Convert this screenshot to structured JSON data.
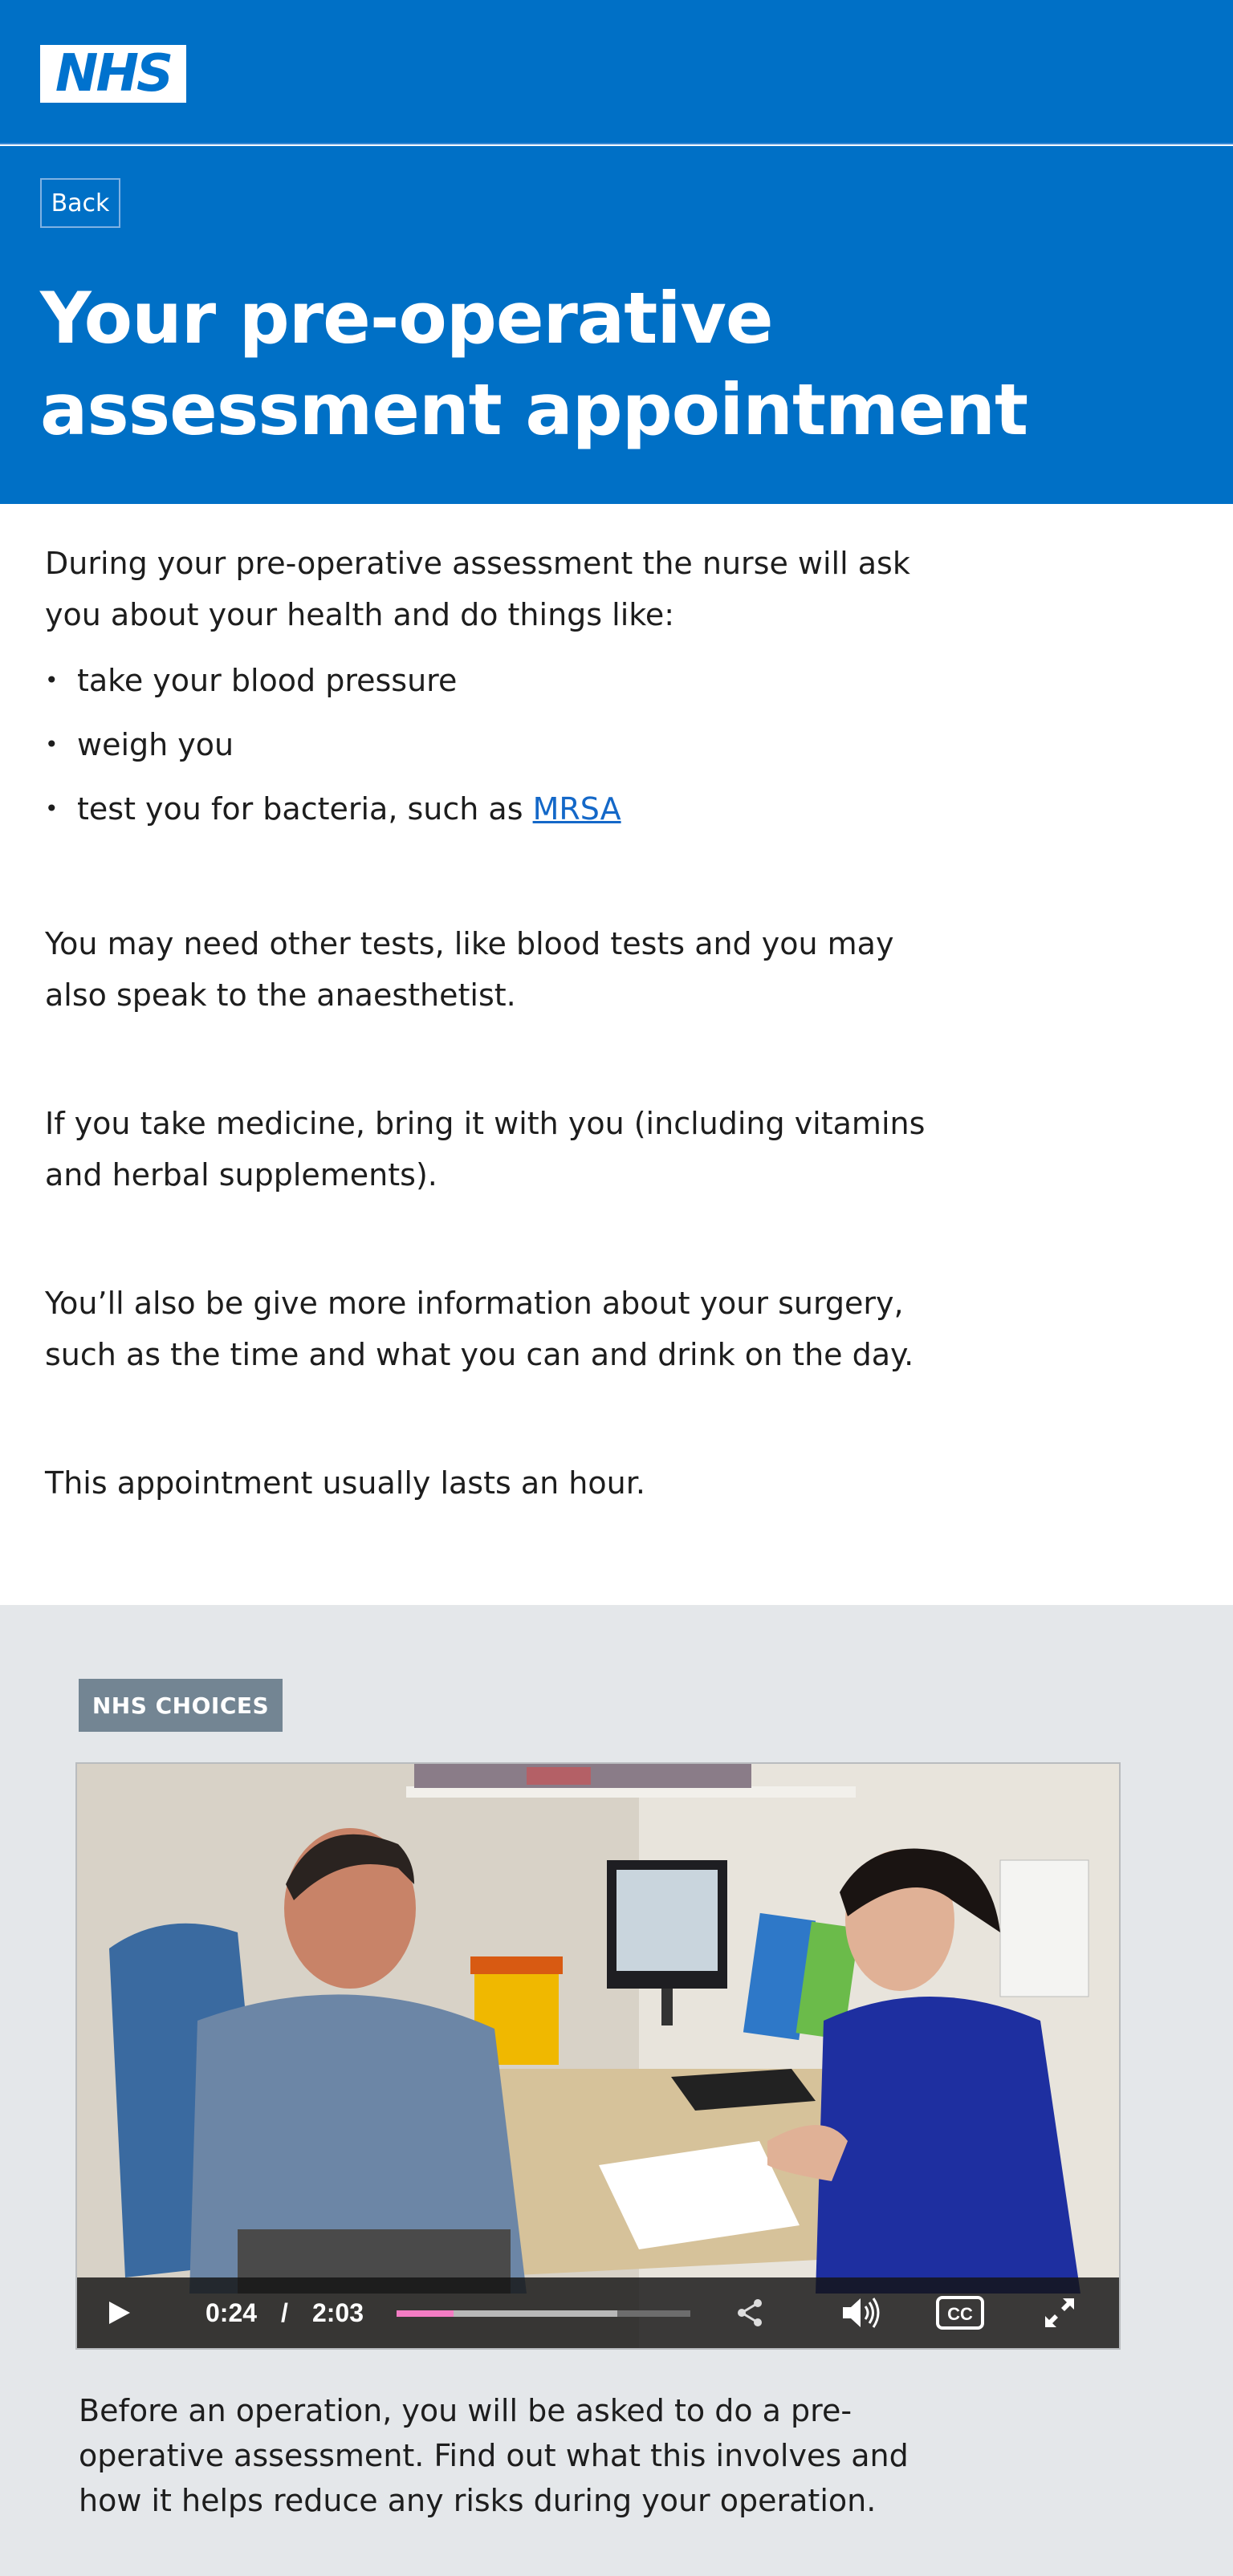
{
  "header": {
    "logo_text": "NHS",
    "brand_color": "#0070c6"
  },
  "hero": {
    "back_label": "Back",
    "title_line1": "Your pre-operative",
    "title_line2": "assessment appointment"
  },
  "content": {
    "intro": "During your pre-operative assessment the nurse will ask you about your health and do things like:",
    "bullets": [
      {
        "text": "take your blood pressure"
      },
      {
        "text": "weigh you"
      },
      {
        "text": "test you for bacteria, such as ",
        "link": "MRSA"
      }
    ],
    "para_tests": "You may need other tests, like blood tests and you may also speak to the anaesthetist.",
    "para_medicine": "If you take medicine, bring it with you (including vitamins and herbal supplements).",
    "para_info": "You’ll also be give more information about your surgery, such as the time and what you can and drink on the day.",
    "para_duration": "This appointment usually lasts an hour."
  },
  "video": {
    "source_badge": "NHS CHOICES",
    "current_time": "0:24",
    "separator": "/",
    "duration": "2:03",
    "played_fraction": 0.195,
    "buffered_fraction": 0.75,
    "progress_color": "#f37cc3",
    "icons": [
      "play-icon",
      "share-icon",
      "volume-icon",
      "closed-captions-icon",
      "fullscreen-icon"
    ],
    "caption": "Before an operation, you will be asked to do a pre-operative assessment. Find out what this involves and how it helps reduce any risks during your operation."
  }
}
